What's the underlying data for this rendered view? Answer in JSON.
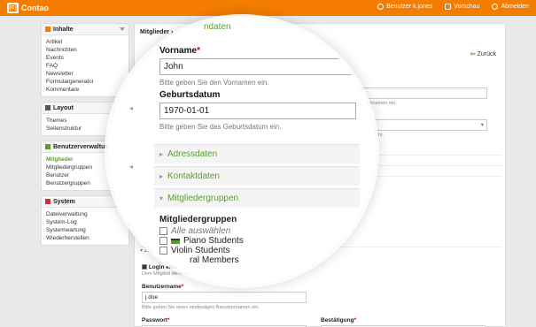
{
  "header": {
    "logo_mark": "[c]",
    "brand": "Contao",
    "nav": [
      {
        "label": "Benutzer k.jones",
        "icon": "user-icon"
      },
      {
        "label": "Vorschau",
        "icon": "monitor-icon"
      },
      {
        "label": "Abmelden",
        "icon": "power-icon"
      }
    ]
  },
  "sidebar": {
    "groups": [
      {
        "title": "Inhalte",
        "icon": "content-icon",
        "items": [
          "Artikel",
          "Nachrichten",
          "Events",
          "FAQ",
          "Newsletter",
          "Formulargenerator",
          "Kommentare"
        ]
      },
      {
        "title": "Layout",
        "icon": "layout-icon",
        "items": [
          "Themes",
          "Seitenstruktur"
        ]
      },
      {
        "title": "Benutzerverwaltung",
        "icon": "users-icon",
        "items": [
          "Mitglieder",
          "Mitgliedergruppen",
          "Benutzer",
          "Benutzergruppen"
        ],
        "active": "Mitglieder"
      },
      {
        "title": "System",
        "icon": "system-icon",
        "items": [
          "Dateiverwaltung",
          "System-Log",
          "Systemwartung",
          "Wiederherstellen"
        ]
      }
    ]
  },
  "main": {
    "title_prefix": "Mitglieder ›",
    "back_label": "Zurück",
    "bg_hint_nachname": "en Nachnamen ein.",
    "bg_hint_geschlecht": "Geschlecht.",
    "login_section": "Zugangsdaten",
    "login_checkbox_label": "Login erlauben",
    "login_checkbox_hint": "Dem Mitglied die Anmeldung im Frontend erlauben.",
    "username_label": "Benutzername",
    "username_value": "j.doe",
    "username_hint": "Bitte geben Sie einen eindeutigen Benutzernamen ein.",
    "password_label": "Passwort",
    "confirm_label": "Bestätigung",
    "bg_f_label": "F"
  },
  "lens": {
    "section_title": "ndaten",
    "firstname_label": "Vorname",
    "firstname_value": "John",
    "firstname_hint": "Bitte geben Sie den Vornamen ein.",
    "dob_label": "Geburtsdatum",
    "dob_value": "1970-01-01",
    "dob_hint": "Bitte geben Sie das Geburtsdatum ein.",
    "sections": [
      "Adressdaten",
      "Kontaktdaten",
      "Mitgliedergruppen"
    ],
    "groups_label": "Mitgliedergruppen",
    "select_all": "Alle auswählen",
    "options": [
      "Piano Students",
      "Violin Students",
      "ral Members"
    ]
  },
  "colors": {
    "brand": "#f47c00",
    "accent": "#5a9e2e"
  }
}
